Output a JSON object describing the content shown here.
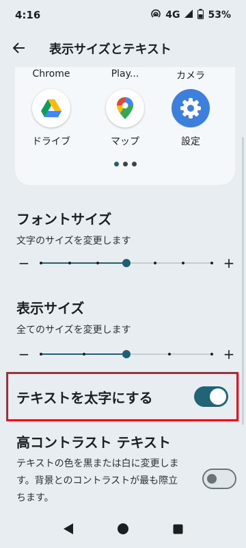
{
  "status": {
    "time": "4:16",
    "network": "4G",
    "battery": "53%"
  },
  "app_bar": {
    "title": "表示サイズとテキスト"
  },
  "preview": {
    "apps": [
      {
        "top_label": "Chrome",
        "bottom_label": "ドライブ",
        "icon": "google-drive-icon"
      },
      {
        "top_label": "Play...",
        "bottom_label": "マップ",
        "icon": "google-maps-icon"
      },
      {
        "top_label": "カメラ",
        "bottom_label": "設定",
        "icon": "settings-gear-icon"
      }
    ],
    "page_count": 3,
    "current_page": 1
  },
  "font_size": {
    "title": "フォントサイズ",
    "subtitle": "文字のサイズを変更します",
    "steps": 7,
    "current_step": 4,
    "decrease_label": "−",
    "increase_label": "+"
  },
  "display_size": {
    "title": "表示サイズ",
    "subtitle": "全てのサイズを変更します",
    "steps": 5,
    "current_step": 3,
    "decrease_label": "−",
    "increase_label": "+"
  },
  "bold_text": {
    "label": "テキストを太字にする",
    "enabled": true
  },
  "high_contrast": {
    "title": "高コントラスト テキスト",
    "description": "テキストの色を黒または白に変更します。背景とのコントラストが最も際立ちます。",
    "enabled": false
  },
  "colors": {
    "accent": "#1f6577",
    "highlight_border": "#e0151f",
    "background": "#e7edf0"
  }
}
